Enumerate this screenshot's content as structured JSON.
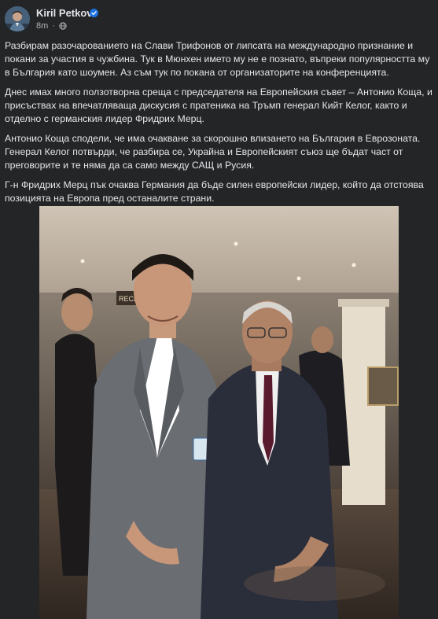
{
  "post": {
    "author": "Kiril Petkov",
    "time": "8m",
    "separator": "·",
    "paragraphs": [
      "Разбирам разочарованието на Слави Трифонов от липсата на международно признание и покани за участия в чужбина. Тук в Мюнхен името му не е познато, въпреки популярността му в България като шоумен. Аз съм тук по покана от организаторите на конференцията.",
      "Днес имах много ползотворна среща с председателя на Европейския съвет – Антонио Коща, и присъствах на впечатляваща дискусия с пратеника на Тръмп генерал Кийт Келог, както и отделно с германския лидер Фридрих Мерц.",
      "Антонио Коща сподели, че има очакване за скорошно влизането на България в Еврозоната. Генерал Келог потвърди, че разбира се, Украйна и Европейският съюз ще бъдат част от преговорите и те няма да са само между САЩ и Русия.",
      "Г-н Фридрих Мерц пък очаква Германия да бъде силен европейски лидер, който да отстоява позицията на Европа пред останалите страни."
    ],
    "photo_sign_text": "RECEPTION"
  },
  "icons": {
    "verified": "verified-badge-icon",
    "audience": "globe-icon"
  },
  "colors": {
    "background": "#242526",
    "text_primary": "#e4e6eb",
    "text_secondary": "#b0b3b8",
    "verified_blue": "#1b74e4"
  }
}
